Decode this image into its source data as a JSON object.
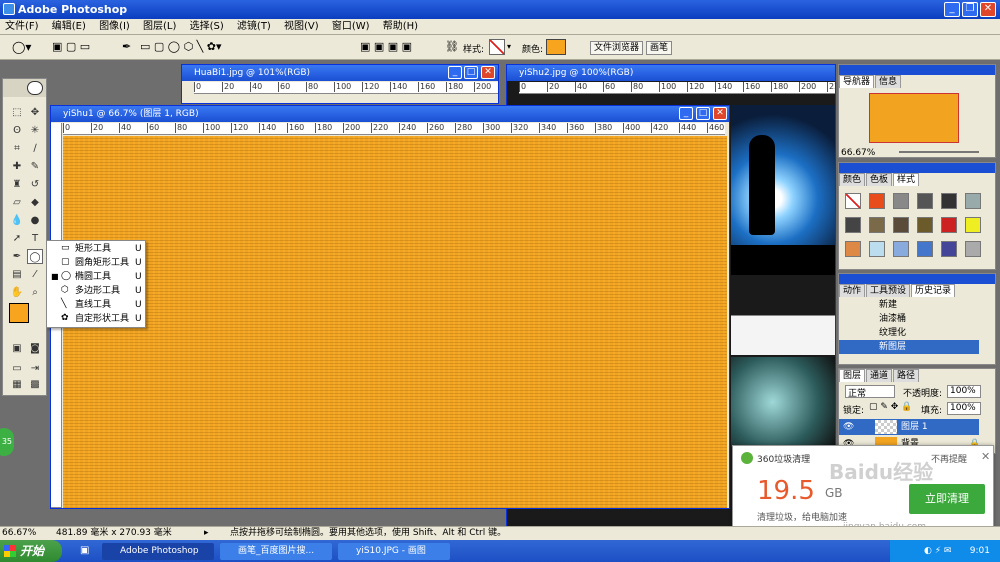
{
  "app": {
    "title": "Adobe Photoshop"
  },
  "menu": [
    "文件(F)",
    "编辑(E)",
    "图像(I)",
    "图层(L)",
    "选择(S)",
    "滤镜(T)",
    "视图(V)",
    "窗口(W)",
    "帮助(H)"
  ],
  "options": {
    "style_label": "样式:",
    "color_label": "颜色:",
    "color": "#f7a51f",
    "tab_file_browser": "文件浏览器",
    "tab_brush": "画笔"
  },
  "windows": {
    "huabi": {
      "title": "HuaBi1.jpg @ 101%(RGB)"
    },
    "yishu2": {
      "title": "yiShu2.jpg @ 100%(RGB)"
    },
    "yishu1": {
      "title": "yiShu1 @ 66.7% (图层 1, RGB)"
    }
  },
  "ruler_ticks": [
    "0",
    "20",
    "40",
    "60",
    "80",
    "100",
    "120",
    "140",
    "160",
    "180",
    "200",
    "220",
    "240",
    "260",
    "280",
    "300",
    "320",
    "340",
    "360",
    "380",
    "400",
    "420",
    "440",
    "460"
  ],
  "flyout": {
    "items": [
      {
        "label": "矩形工具",
        "key": "U",
        "icon": "▭"
      },
      {
        "label": "圆角矩形工具",
        "key": "U",
        "icon": "▢"
      },
      {
        "label": "椭圆工具",
        "key": "U",
        "icon": "◯",
        "selected": "■"
      },
      {
        "label": "多边形工具",
        "key": "U",
        "icon": "⬡"
      },
      {
        "label": "直线工具",
        "key": "U",
        "icon": "╲"
      },
      {
        "label": "自定形状工具",
        "key": "U",
        "icon": "✿"
      }
    ]
  },
  "navigator": {
    "tabs": [
      "导航器",
      "信息"
    ],
    "zoom": "66.67%"
  },
  "styles": {
    "tabs": [
      "颜色",
      "色板",
      "样式"
    ]
  },
  "history": {
    "tabs": [
      "动作",
      "工具预设",
      "历史记录"
    ],
    "items": [
      {
        "label": "新建"
      },
      {
        "label": "油漆桶"
      },
      {
        "label": "纹理化"
      },
      {
        "label": "新图层"
      }
    ]
  },
  "layers": {
    "tabs": [
      "图层",
      "通道",
      "路径"
    ],
    "mode": "正常",
    "opacity_label": "不透明度:",
    "opacity": "100%",
    "lock_label": "锁定:",
    "fill_label": "填充:",
    "fill": "100%",
    "items": [
      {
        "name": "图层 1"
      },
      {
        "name": "背景"
      }
    ]
  },
  "status": {
    "zoom": "66.67%",
    "size": "481.89 毫米 x 270.93 毫米",
    "hint": "点按并拖移可绘制椭圆。要用其他选项，使用 Shift、Alt 和 Ctrl 键。"
  },
  "popup": {
    "title": "360垃圾清理",
    "dismiss": "不再提醒",
    "big": "19.5",
    "unit": "GB",
    "desc": "清理垃圾，给电脑加速",
    "button": "立即清理"
  },
  "watermark": {
    "brand": "Baidu经验",
    "url": "jingyan.baidu.com"
  },
  "taskbar": {
    "start": "开始",
    "tasks": [
      "Adobe Photoshop",
      "画笔_百度图片搜...",
      "yiS10.JPG - 画图"
    ],
    "clock": "9:01"
  },
  "side_badge": "35"
}
